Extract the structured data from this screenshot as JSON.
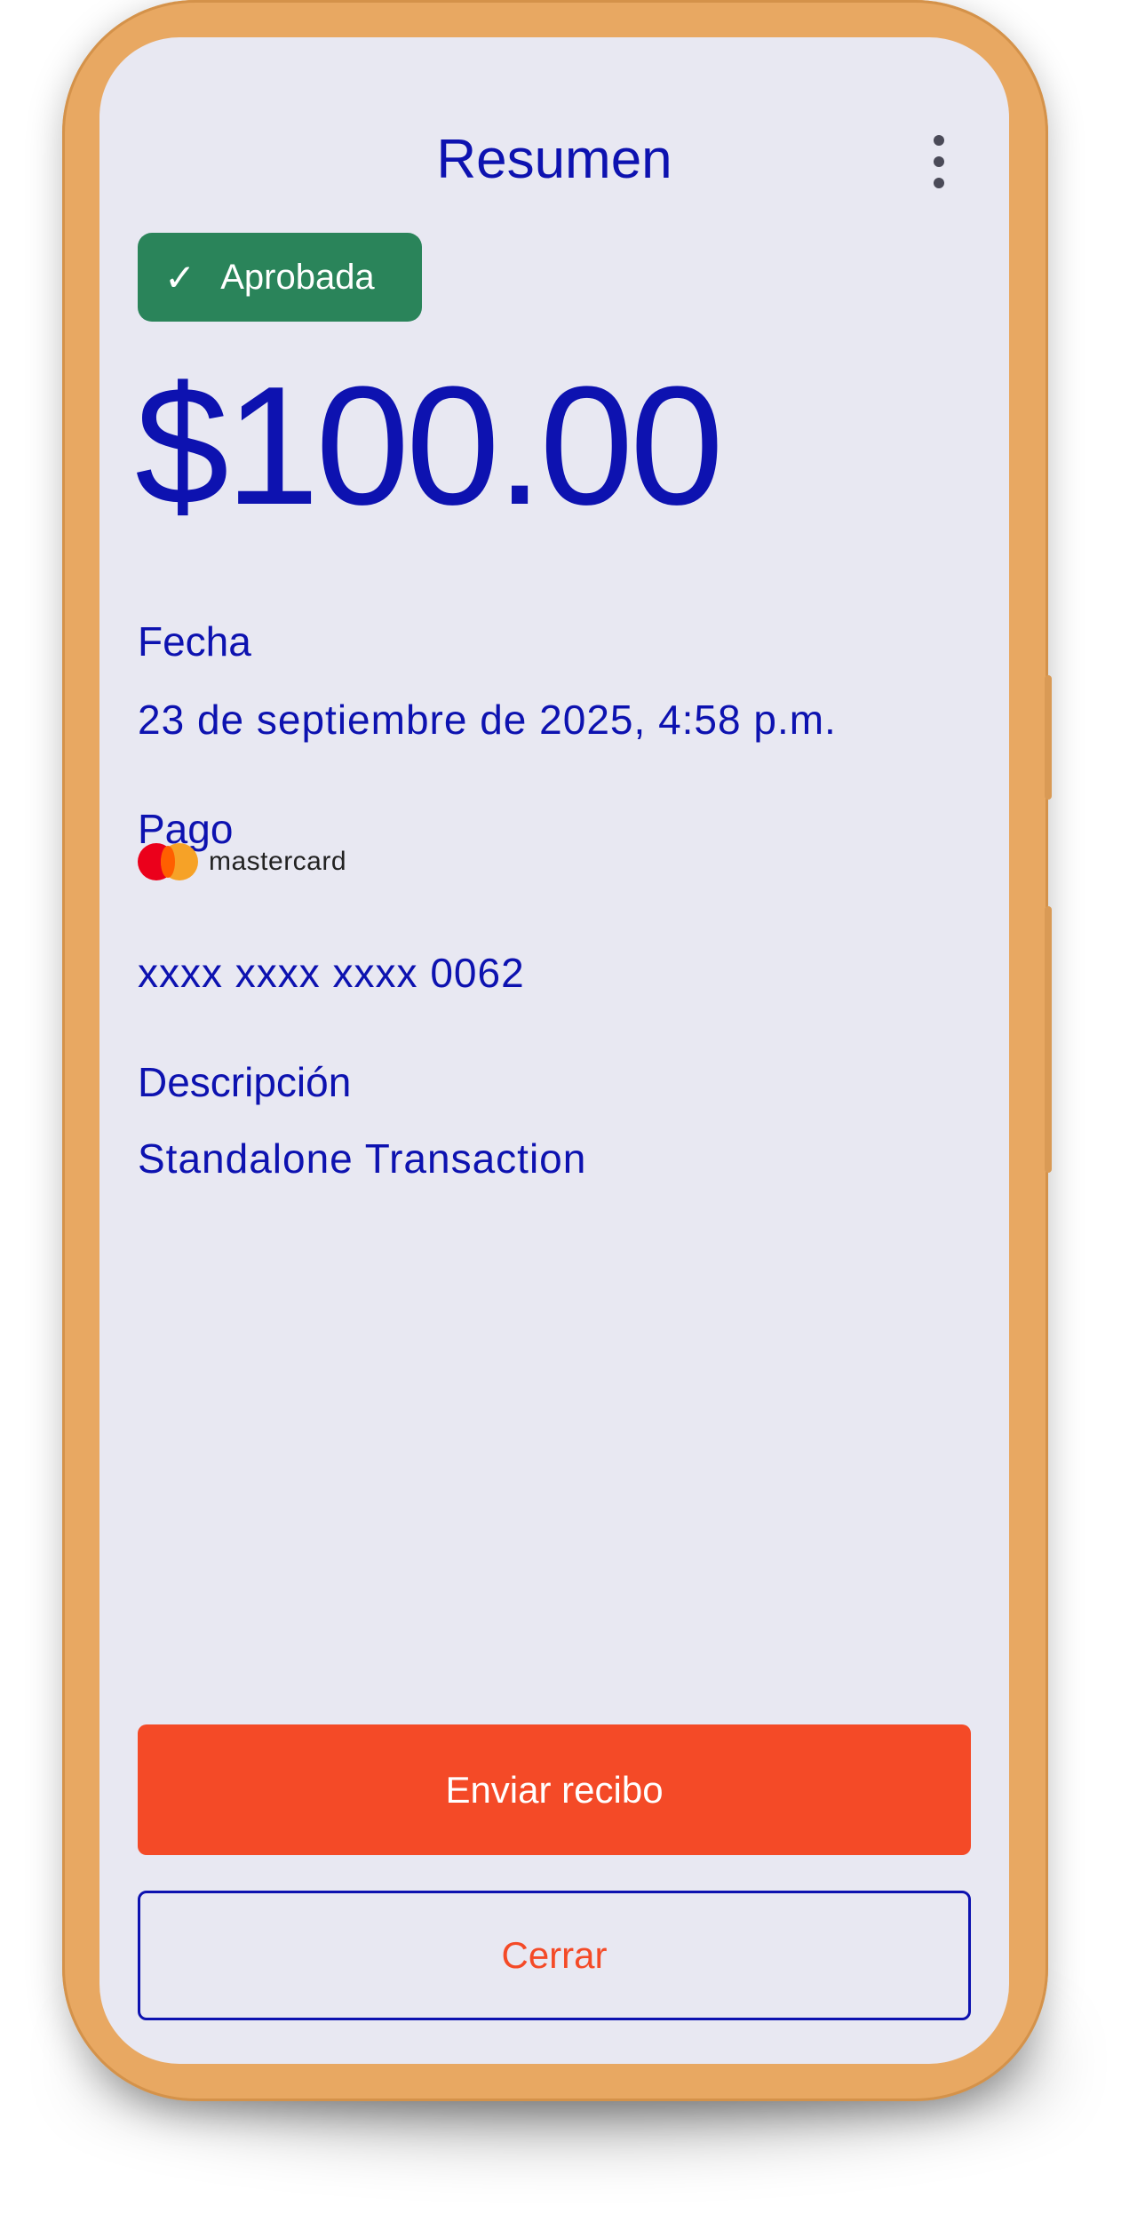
{
  "header": {
    "title": "Resumen",
    "menu_icon": "more-vert-icon"
  },
  "status": {
    "label": "Aprobada",
    "icon": "check-icon",
    "color": "#2A845A"
  },
  "amount": "$100.00",
  "details": {
    "date_label": "Fecha",
    "date_value": "23 de septiembre de 2025, 4:58 p.m.",
    "payment_label": "Pago",
    "card_brand": "mastercard",
    "card_number": "xxxx xxxx xxxx 0062",
    "description_label": "Descripción",
    "description_value": "Standalone Transaction"
  },
  "actions": {
    "send_receipt": "Enviar recibo",
    "close": "Cerrar"
  },
  "colors": {
    "primary_text": "#0D12B0",
    "accent": "#F44A27",
    "background": "#E8E8F2"
  }
}
